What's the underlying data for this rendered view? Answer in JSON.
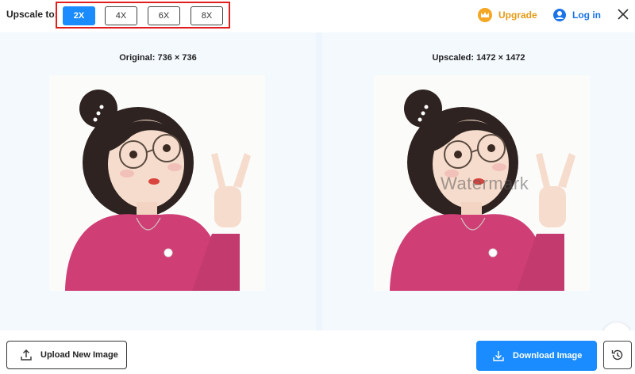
{
  "toolbar": {
    "upscale_label": "Upscale to:",
    "scales": [
      "2X",
      "4X",
      "6X",
      "8X"
    ],
    "selected_scale": "2X",
    "upgrade_label": "Upgrade",
    "login_label": "Log in"
  },
  "panels": {
    "original_title": "Original: 736 × 736",
    "upscaled_title": "Upscaled: 1472 × 1472",
    "watermark": "Watermark"
  },
  "actions": {
    "upload_label": "Upload New Image",
    "download_label": "Download Image"
  },
  "colors": {
    "accent": "#1a8cff",
    "upgrade": "#e39a16",
    "login": "#1a73e8",
    "highlight_border": "#e01e1e",
    "sweater": "#cf3f76"
  },
  "icons": [
    "crown-icon",
    "user-icon",
    "close-icon",
    "compare-icon",
    "upload-icon",
    "download-icon",
    "history-icon"
  ]
}
